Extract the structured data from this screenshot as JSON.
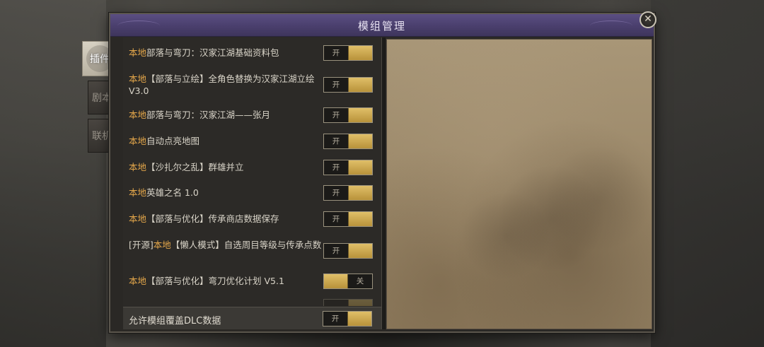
{
  "dialog": {
    "title": "模组管理",
    "close_label": "✕"
  },
  "tabs": [
    {
      "label": "插件",
      "active": true
    },
    {
      "label": "剧本",
      "active": false
    },
    {
      "label": "联机",
      "active": false
    }
  ],
  "mods": [
    {
      "prefix": "",
      "tag": "本地",
      "name": "部落与弯刀：汉家江湖基础资料包",
      "state": "开",
      "on": true
    },
    {
      "prefix": "",
      "tag": "本地",
      "name": "【部落与立绘】全角色替换为汉家江湖立绘 V3.0",
      "state": "开",
      "on": true
    },
    {
      "prefix": "",
      "tag": "本地",
      "name": "部落与弯刀：汉家江湖——张月",
      "state": "开",
      "on": true
    },
    {
      "prefix": "",
      "tag": "本地",
      "name": "自动点亮地图",
      "state": "开",
      "on": true
    },
    {
      "prefix": "",
      "tag": "本地",
      "name": "【沙扎尔之乱】群雄并立",
      "state": "开",
      "on": true
    },
    {
      "prefix": "",
      "tag": "本地",
      "name": "英雄之名 1.0",
      "state": "开",
      "on": true
    },
    {
      "prefix": "",
      "tag": "本地",
      "name": "【部落与优化】传承商店数据保存",
      "state": "开",
      "on": true
    },
    {
      "prefix": "[开源]",
      "tag": "本地",
      "name": "【懒人模式】自选周目等级与传承点数",
      "state": "开",
      "on": true
    },
    {
      "prefix": "",
      "tag": "本地",
      "name": "【部落与优化】弯刀优化计划 V5.1",
      "state": "关",
      "on": false
    }
  ],
  "bottom": {
    "label": "允许模组覆盖DLC数据",
    "state": "开",
    "on": true
  },
  "colors": {
    "title_bar": "#4a3f6d",
    "local_tag": "#e3a64a",
    "toggle_knob": "#d2b060",
    "preview_parchment": "#a08e70"
  }
}
